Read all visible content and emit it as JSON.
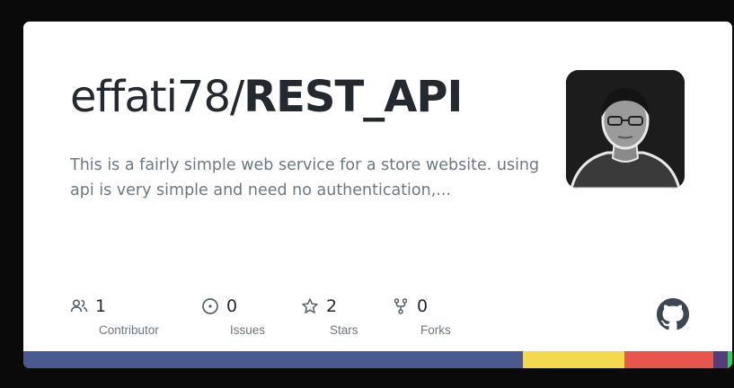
{
  "repo": {
    "owner": "effati78/",
    "name": "REST_API",
    "description": "This is a fairly simple web service for a store website. using api is very simple and need no authentication,..."
  },
  "stats": [
    {
      "icon": "people-icon",
      "value": "1",
      "label": "Contributor"
    },
    {
      "icon": "issue-icon",
      "value": "0",
      "label": "Issues"
    },
    {
      "icon": "star-icon",
      "value": "2",
      "label": "Stars"
    },
    {
      "icon": "fork-icon",
      "value": "0",
      "label": "Forks"
    }
  ],
  "colors": {
    "background": "#0a0a0a",
    "card": "#ffffff",
    "title": "#24292f",
    "muted": "#6e7781",
    "language_bar": [
      "#4b5a8e",
      "#f2d94e",
      "#e8554c",
      "#563d7c",
      "#2fd05c"
    ],
    "language_bar_share": [
      0.705,
      0.143,
      0.125,
      0.021,
      0.006
    ]
  }
}
